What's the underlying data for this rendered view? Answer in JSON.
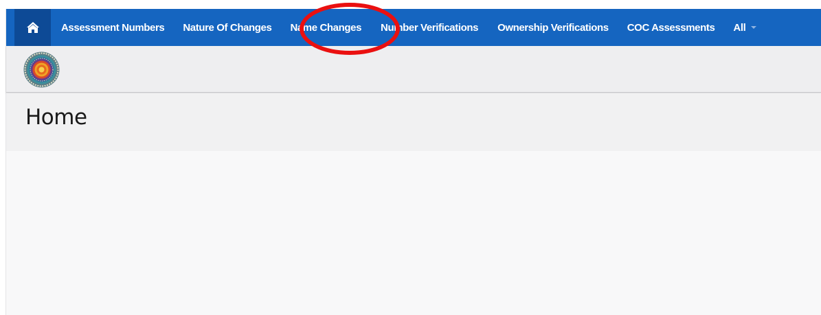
{
  "nav": {
    "home_icon": "home-icon",
    "items": [
      {
        "label": "Assessment Numbers"
      },
      {
        "label": "Nature Of Changes"
      },
      {
        "label": "Name Changes"
      },
      {
        "label": "Number Verifications"
      },
      {
        "label": "Ownership Verifications"
      },
      {
        "label": "COC Assessments"
      },
      {
        "label": "All"
      }
    ],
    "colors": {
      "bar": "#1565c0",
      "home_bg": "#0d4a96"
    }
  },
  "logo": {
    "icon": "emblem-logo"
  },
  "page": {
    "title": "Home"
  },
  "annotation": {
    "color": "#ea1010",
    "target": "Name Changes"
  }
}
